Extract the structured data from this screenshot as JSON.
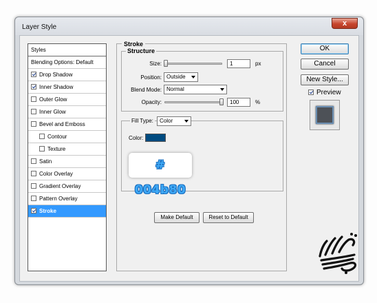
{
  "window": {
    "title": "Layer Style",
    "close_glyph": "x"
  },
  "sidebar": {
    "header": "Styles",
    "items": [
      {
        "label": "Blending Options: Default",
        "checkbox": false
      },
      {
        "label": "Drop Shadow",
        "checkbox": true,
        "checked": true
      },
      {
        "label": "Inner Shadow",
        "checkbox": true,
        "checked": true
      },
      {
        "label": "Outer Glow",
        "checkbox": true,
        "checked": false
      },
      {
        "label": "Inner Glow",
        "checkbox": true,
        "checked": false
      },
      {
        "label": "Bevel and Emboss",
        "checkbox": true,
        "checked": false
      },
      {
        "label": "Contour",
        "checkbox": true,
        "checked": false,
        "sub": true
      },
      {
        "label": "Texture",
        "checkbox": true,
        "checked": false,
        "sub": true
      },
      {
        "label": "Satin",
        "checkbox": true,
        "checked": false
      },
      {
        "label": "Color Overlay",
        "checkbox": true,
        "checked": false
      },
      {
        "label": "Gradient Overlay",
        "checkbox": true,
        "checked": false
      },
      {
        "label": "Pattern Overlay",
        "checkbox": true,
        "checked": false
      },
      {
        "label": "Stroke",
        "checkbox": true,
        "checked": true,
        "selected": true
      }
    ]
  },
  "stroke": {
    "title": "Stroke",
    "structure": {
      "title": "Structure",
      "size_label": "Size:",
      "size_value": "1",
      "size_unit": "px",
      "size_slider_fraction": 0.02,
      "position_label": "Position:",
      "position_value": "Outside",
      "blend_mode_label": "Blend Mode:",
      "blend_mode_value": "Normal",
      "opacity_label": "Opacity:",
      "opacity_value": "100",
      "opacity_unit": "%",
      "opacity_slider_fraction": 1.0
    },
    "fill_type_label": "Fill Type:",
    "fill_type_value": "Color",
    "color_label": "Color:",
    "color_hex": "#004b80",
    "color_callout": "# 004b80",
    "make_default_label": "Make Default",
    "reset_default_label": "Reset to Default"
  },
  "buttons": {
    "ok": "OK",
    "cancel": "Cancel",
    "new_style": "New Style...",
    "preview_label": "Preview",
    "preview_checked": true
  }
}
